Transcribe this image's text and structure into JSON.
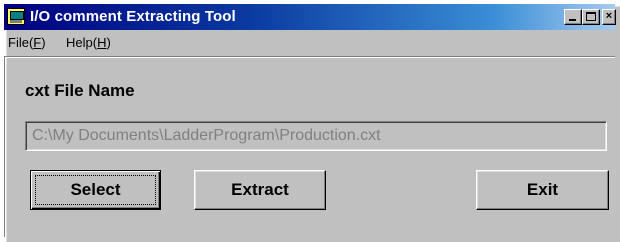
{
  "window": {
    "title": "I/O comment Extracting Tool",
    "icon": "app-icon"
  },
  "titlebar_buttons": {
    "minimize_icon": "minimize-icon",
    "maximize_icon": "maximize-icon",
    "close_glyph": "×"
  },
  "menu": {
    "items": [
      {
        "label": "File(F)",
        "name": "File",
        "accel": "F"
      },
      {
        "label": "Help(H)",
        "name": "Help",
        "accel": "H"
      }
    ]
  },
  "form": {
    "file_label": "cxt File Name",
    "path_value": "C:\\My Documents\\LadderProgram\\Production.cxt",
    "path_enabled": false
  },
  "buttons": {
    "select": "Select",
    "extract": "Extract",
    "exit": "Exit"
  },
  "colors": {
    "titlebar_start": "#000080",
    "titlebar_end": "#a6caf0",
    "face": "#c0c0c0",
    "disabled_text": "#808080"
  }
}
